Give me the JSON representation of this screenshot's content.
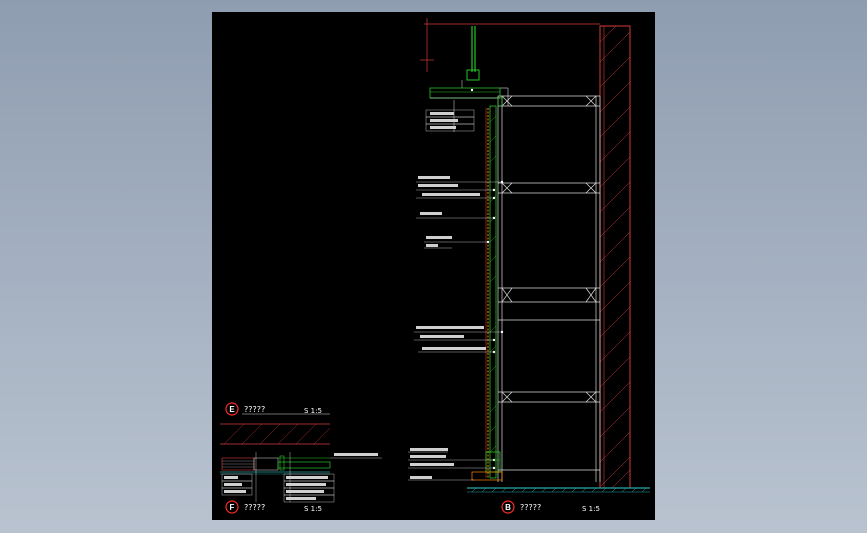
{
  "colors": {
    "background": "#000000",
    "wall": "#d23a3a",
    "insulation": "#29c429",
    "frame": "#e0e0e0",
    "callout_marker": "#ff2a2a",
    "floor_hatch": "#24b8b8",
    "ground": "#2aa7a7",
    "finish": "#ff8a00"
  },
  "details": [
    {
      "marker": "E",
      "title": "?????",
      "scale": "S 1:5"
    },
    {
      "marker": "F",
      "title": "?????",
      "scale": "S 1:5"
    },
    {
      "marker": "B",
      "title": "?????",
      "scale": "S 1:5"
    }
  ]
}
